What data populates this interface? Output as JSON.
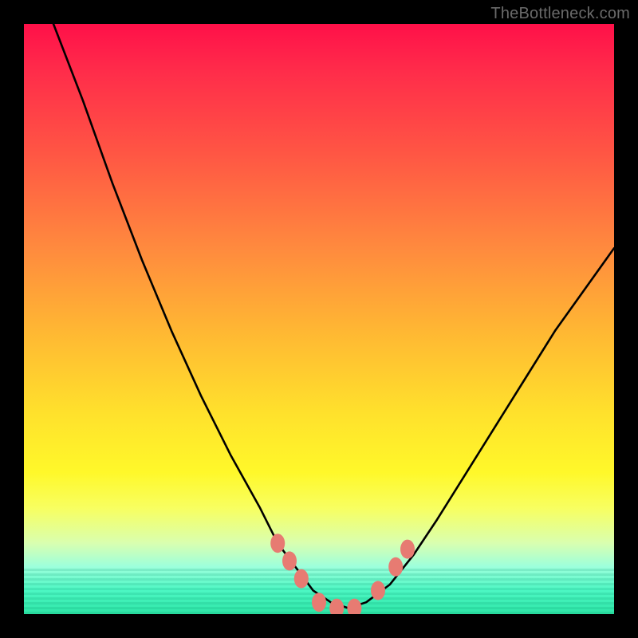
{
  "watermark": "TheBottleneck.com",
  "chart_data": {
    "type": "line",
    "title": "",
    "xlabel": "",
    "ylabel": "",
    "xlim": [
      0,
      100
    ],
    "ylim": [
      0,
      100
    ],
    "grid": false,
    "legend": false,
    "series": [
      {
        "name": "main-curve",
        "color": "#000000",
        "x": [
          5,
          10,
          15,
          20,
          25,
          30,
          35,
          40,
          43,
          46,
          49,
          52,
          55,
          58,
          62,
          66,
          70,
          75,
          80,
          85,
          90,
          95,
          100
        ],
        "y": [
          100,
          87,
          73,
          60,
          48,
          37,
          27,
          18,
          12,
          8,
          4,
          2,
          1,
          2,
          5,
          10,
          16,
          24,
          32,
          40,
          48,
          55,
          62
        ]
      }
    ],
    "markers": [
      {
        "name": "marker-left-1",
        "x": 43,
        "y": 12,
        "color": "#e77b72"
      },
      {
        "name": "marker-left-2",
        "x": 45,
        "y": 9,
        "color": "#e77b72"
      },
      {
        "name": "marker-left-3",
        "x": 47,
        "y": 6,
        "color": "#e77b72"
      },
      {
        "name": "marker-bottom-1",
        "x": 50,
        "y": 2,
        "color": "#e77b72"
      },
      {
        "name": "marker-bottom-2",
        "x": 53,
        "y": 1,
        "color": "#e77b72"
      },
      {
        "name": "marker-bottom-3",
        "x": 56,
        "y": 1,
        "color": "#e77b72"
      },
      {
        "name": "marker-right-1",
        "x": 60,
        "y": 4,
        "color": "#e77b72"
      },
      {
        "name": "marker-right-2",
        "x": 63,
        "y": 8,
        "color": "#e77b72"
      },
      {
        "name": "marker-right-3",
        "x": 65,
        "y": 11,
        "color": "#e77b72"
      }
    ]
  }
}
